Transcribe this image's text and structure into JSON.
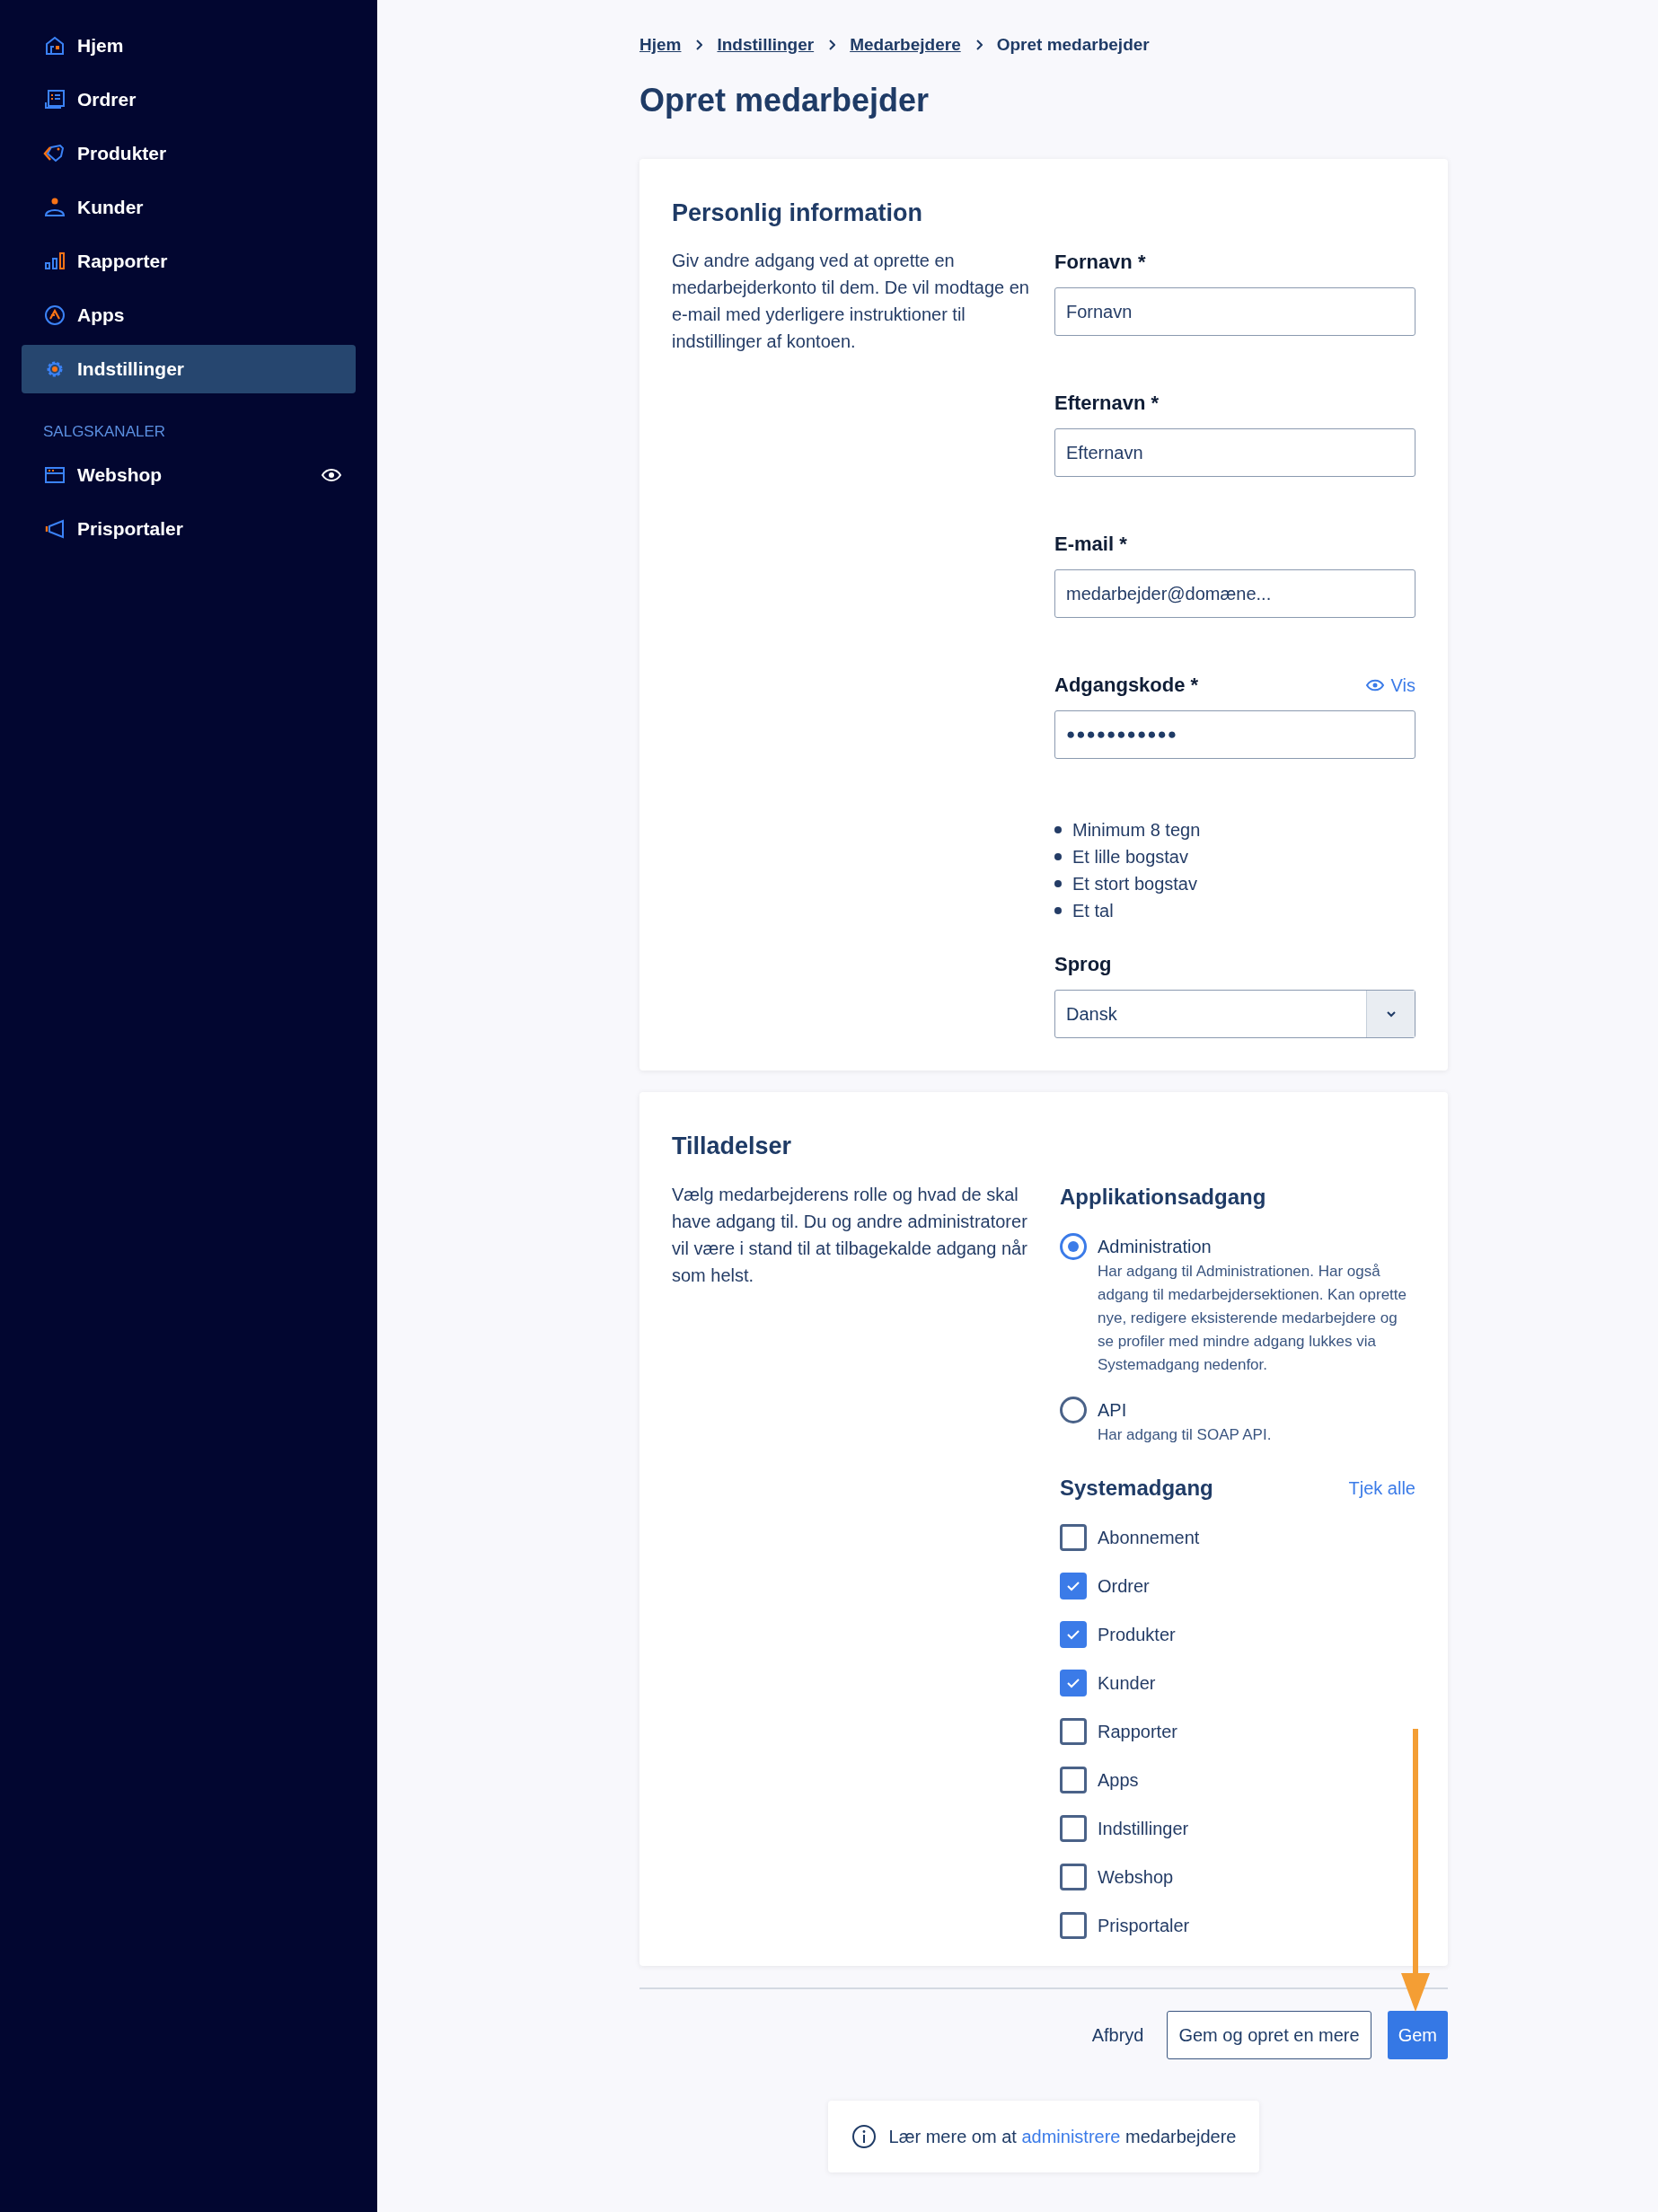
{
  "sidebar": {
    "items": [
      {
        "label": "Hjem",
        "selected": false
      },
      {
        "label": "Ordrer",
        "selected": false
      },
      {
        "label": "Produkter",
        "selected": false
      },
      {
        "label": "Kunder",
        "selected": false
      },
      {
        "label": "Rapporter",
        "selected": false
      },
      {
        "label": "Apps",
        "selected": false
      },
      {
        "label": "Indstillinger",
        "selected": true
      }
    ],
    "section_label": "SALGSKANALER",
    "channels": [
      {
        "label": "Webshop",
        "visible": true
      },
      {
        "label": "Prisportaler",
        "visible": false
      }
    ]
  },
  "breadcrumb": [
    {
      "label": "Hjem",
      "kind": "link"
    },
    {
      "label": "Indstillinger",
      "kind": "link"
    },
    {
      "label": "Medarbejdere",
      "kind": "link"
    },
    {
      "label": "Opret medarbejder",
      "kind": "current"
    }
  ],
  "title": "Opret medarbejder",
  "personal": {
    "heading": "Personlig information",
    "description": "Giv andre adgang ved at oprette en medarbejderkonto til dem. De vil modtage en e-mail med yderligere instruktioner til indstillinger af kontoen.",
    "fields": [
      {
        "label": "Fornavn *",
        "kind": "text",
        "placeholder": "Fornavn"
      },
      {
        "label": "Efternavn *",
        "kind": "text",
        "placeholder": "Efternavn"
      },
      {
        "label": "E-mail *",
        "kind": "text",
        "placeholder": "medarbejder@domæne..."
      },
      {
        "label": "Adgangskode *",
        "kind": "password",
        "value": "●●●●●●●●●●●",
        "toggle": "Vis"
      }
    ],
    "requirements": [
      "Minimum 8 tegn",
      "Et lille bogstav",
      "Et stort bogstav",
      "Et tal"
    ],
    "language": {
      "label": "Sprog",
      "value": "Dansk"
    }
  },
  "permissions": {
    "heading": "Tilladelser",
    "description": "Vælg medarbejderens rolle og hvad de skal have adgang til. Du og andre administratorer vil være i stand til at tilbagekalde adgang når som helst.",
    "app_access": {
      "heading": "Applikationsadgang",
      "options": [
        {
          "label": "Administration",
          "description": "Har adgang til Administrationen. Har også adgang til medarbejdersektionen. Kan oprette nye, redigere eksisterende medarbejdere og se profiler med mindre adgang lukkes via Systemadgang nedenfor.",
          "selected": true
        },
        {
          "label": "API",
          "description": "Har adgang til SOAP API.",
          "selected": false
        }
      ]
    },
    "system_access": {
      "heading": "Systemadgang",
      "check_all": "Tjek alle",
      "items": [
        {
          "label": "Abonnement",
          "checked": false
        },
        {
          "label": "Ordrer",
          "checked": true
        },
        {
          "label": "Produkter",
          "checked": true
        },
        {
          "label": "Kunder",
          "checked": true
        },
        {
          "label": "Rapporter",
          "checked": false
        },
        {
          "label": "Apps",
          "checked": false
        },
        {
          "label": "Indstillinger",
          "checked": false
        },
        {
          "label": "Webshop",
          "checked": false
        },
        {
          "label": "Prisportaler",
          "checked": false
        }
      ]
    }
  },
  "actions": [
    {
      "label": "Afbryd",
      "kind": "text"
    },
    {
      "label": "Gem og opret en mere",
      "kind": "outline"
    },
    {
      "label": "Gem",
      "kind": "primary"
    }
  ],
  "info": {
    "before": "Lær mere om at",
    "link": "administrere",
    "after": "medarbejdere"
  }
}
